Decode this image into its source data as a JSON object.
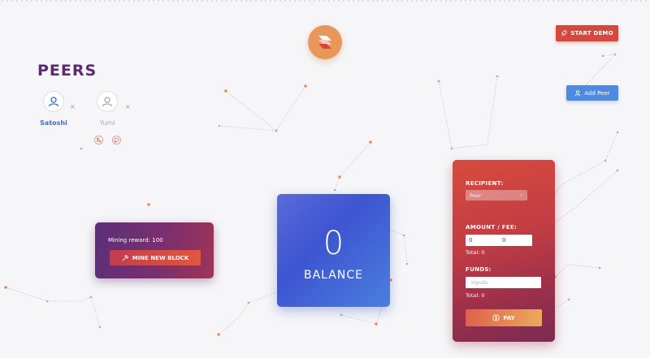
{
  "header": {
    "logo_icon": "blockchain-logo-icon",
    "start_demo_label": "START DEMO",
    "start_demo_icon": "rocket-icon",
    "add_peer_label": "Add Peer",
    "add_peer_icon": "user-icon"
  },
  "peers": {
    "title": "PEERS",
    "items": [
      {
        "name": "Satoshi",
        "active": true,
        "remove": "×"
      },
      {
        "name": "Yumi",
        "active": false,
        "remove": "×"
      }
    ]
  },
  "mining": {
    "reward_text": "Mining reward: 100",
    "button_label": "MINE NEW BLOCK",
    "button_icon": "hammer-icon"
  },
  "balance": {
    "value": "0",
    "label": "BALANCE"
  },
  "payment": {
    "recipient_label": "RECIPIENT:",
    "recipient_value": "Peer",
    "amount_label": "AMOUNT / FEE:",
    "amount_value": "0",
    "fee_value": "0",
    "amount_total": "Total: 0",
    "funds_label": "FUNDS:",
    "funds_placeholder": "Inputs",
    "funds_total": "Total: 0",
    "pay_label": "PAY",
    "pay_icon": "dollar-icon"
  },
  "colors": {
    "background": "#f6f6f8",
    "peers_title": "#5b2a73",
    "start_demo": "#d5483e",
    "add_peer": "#4c8be1",
    "network_node": "#e88b4f",
    "network_line": "#b9bcd6"
  }
}
